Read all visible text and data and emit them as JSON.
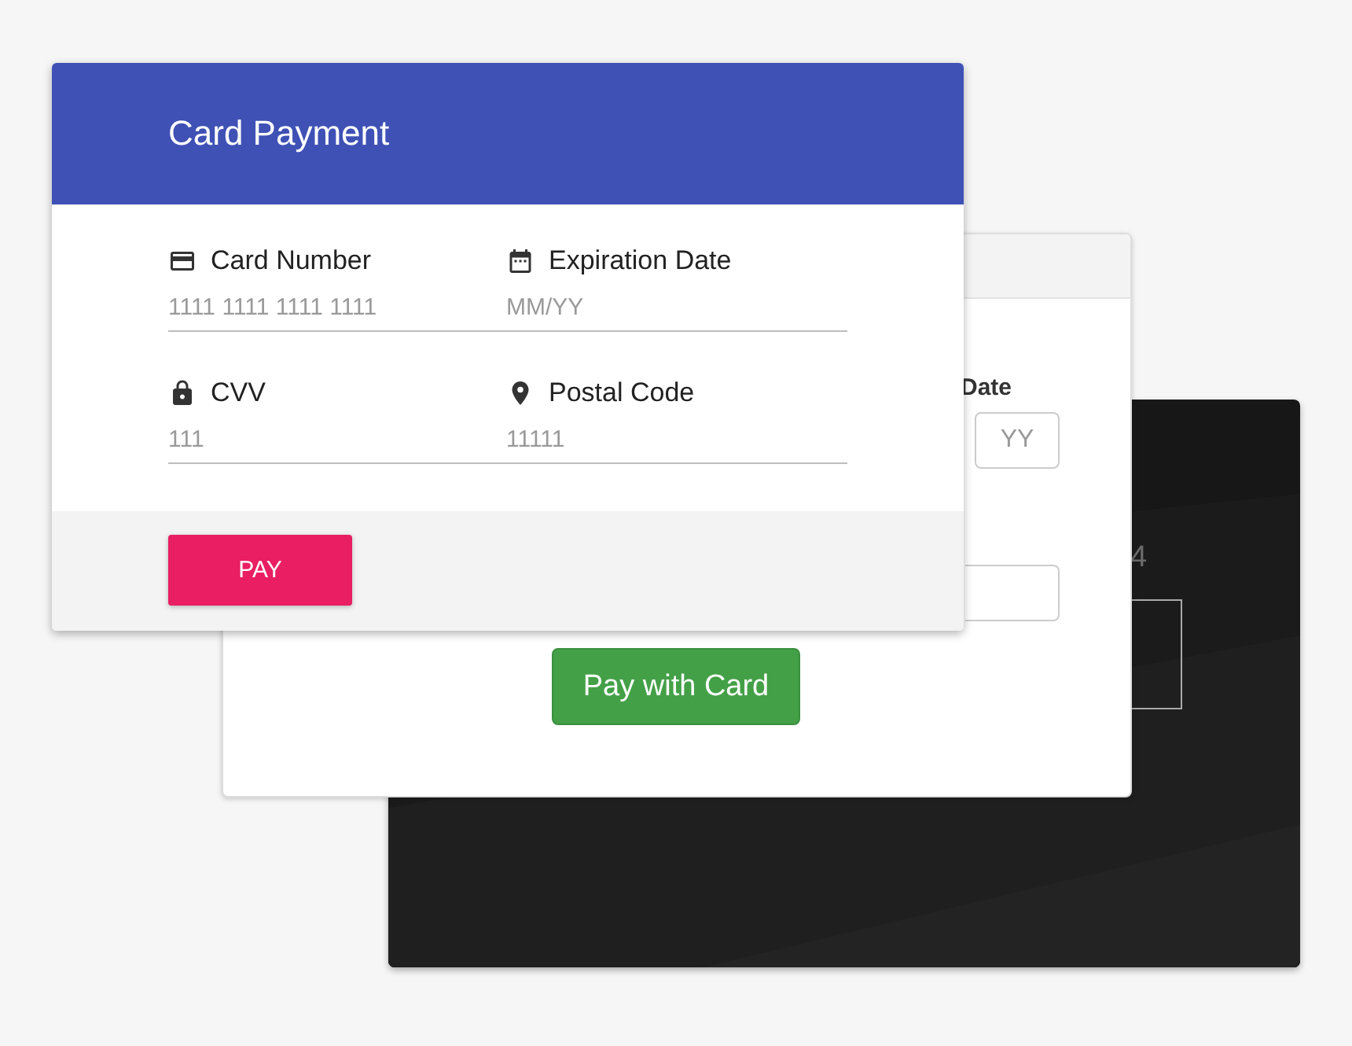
{
  "back_card": {
    "number_fragment": "4"
  },
  "middle_window": {
    "label": "Date",
    "year_field": {
      "placeholder": "YY"
    },
    "button": "Pay with Card"
  },
  "front_window": {
    "title": "Card Payment",
    "fields": [
      {
        "kind": "card",
        "label": "Card Number",
        "placeholder": "1111 1111 1111 1111"
      },
      {
        "kind": "calendar",
        "label": "Expiration Date",
        "placeholder": "MM/YY"
      },
      {
        "kind": "lock",
        "label": "CVV",
        "placeholder": "111"
      },
      {
        "kind": "pin",
        "label": "Postal Code",
        "placeholder": "11111"
      }
    ],
    "button": "PAY"
  }
}
